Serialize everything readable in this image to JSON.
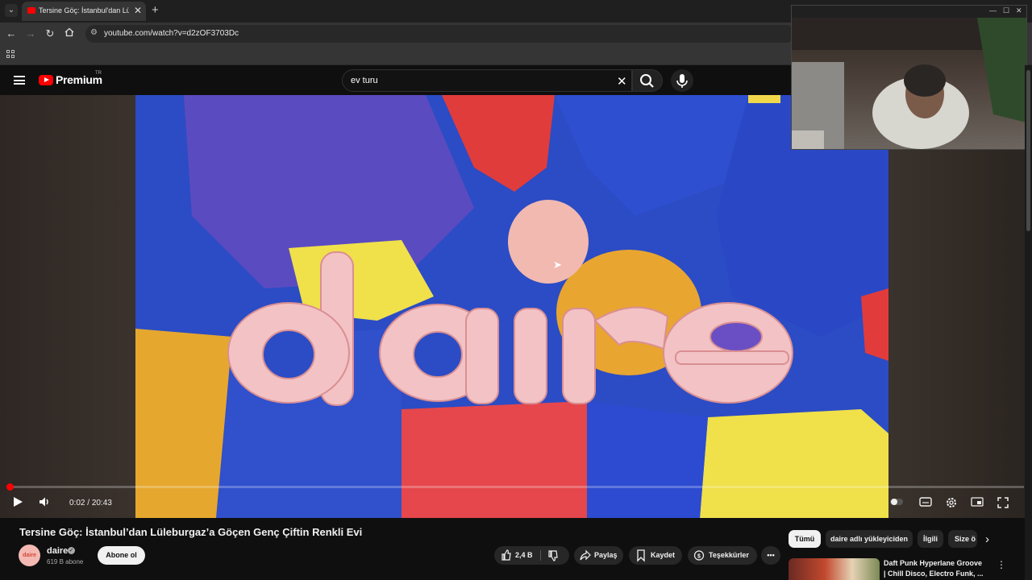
{
  "browser": {
    "tab_title": "Tersine Göç: İstanbul'dan Lüleburgaz'a",
    "url": "youtube.com/watch?v=d2zOF3703Dc"
  },
  "masthead": {
    "logo_text": "Premium",
    "country_code": "TR",
    "search_value": "ev turu"
  },
  "player": {
    "time_current": "0:02",
    "time_separator": "/",
    "time_total": "20:43",
    "progress_fraction": 0.0016,
    "logo_word": "daire"
  },
  "video": {
    "title": "Tersine Göç: İstanbul’dan Lüleburgaz’a Göçen Genç Çiftin Renkli Evi",
    "channel_name": "daire",
    "subscribers": "619 B abone",
    "subscribe_label": "Abone ol",
    "like_count": "2,4 B",
    "share_label": "Paylaş",
    "save_label": "Kaydet",
    "thanks_label": "Teşekkürler"
  },
  "filter_chips": [
    "Tümü",
    "daire adlı yükleyiciden",
    "İlgili",
    "Size ö"
  ],
  "recommendation": {
    "title_line1": "Daft Punk Hyperlane Groove",
    "title_line2": "| Chill Disco, Electro Funk, ..."
  },
  "colors": {
    "accent_red": "#ff0000",
    "background": "#0f0f0f",
    "chip_bg": "#272727"
  }
}
